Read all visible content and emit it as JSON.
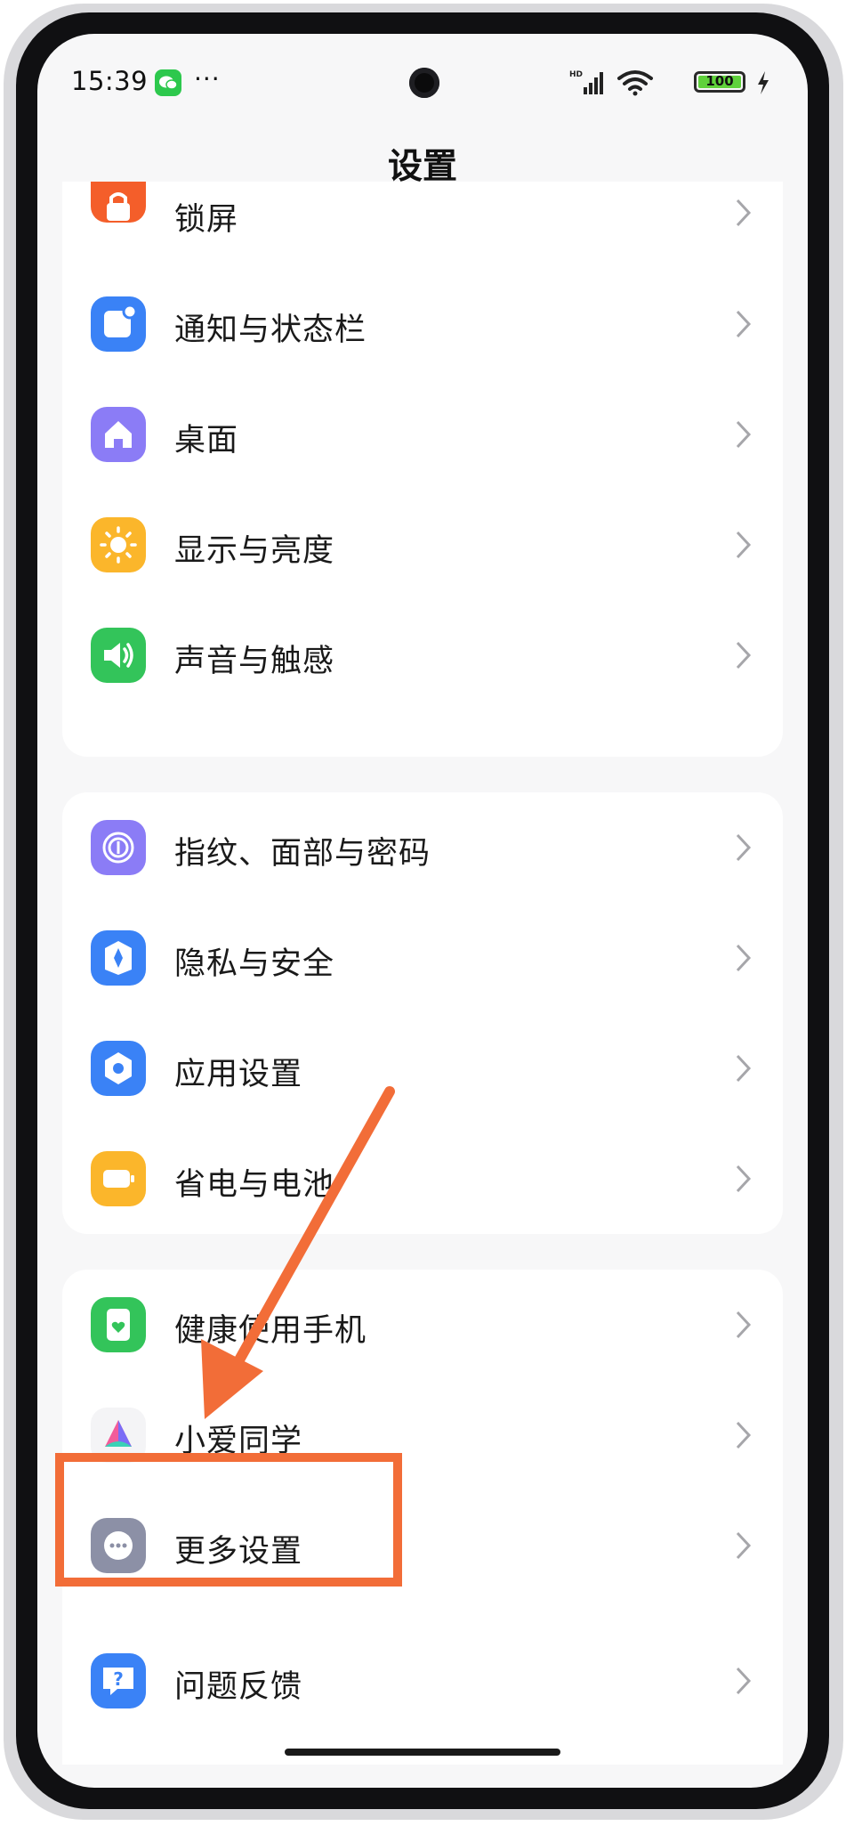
{
  "status_bar": {
    "time": "15:39",
    "more": "···",
    "battery": "100"
  },
  "header": {
    "title": "设置"
  },
  "colors": {
    "orange": "#f45e2a",
    "blue": "#3a82f6",
    "purple": "#8b7cf6",
    "yellow": "#fbb62b",
    "green": "#33c45a",
    "gray": "#8c90a6",
    "annotation": "#f26d38"
  },
  "groups": [
    {
      "items": [
        {
          "label": "锁屏",
          "icon": "lock-icon"
        },
        {
          "label": "通知与状态栏",
          "icon": "notification-icon"
        },
        {
          "label": "桌面",
          "icon": "home-icon"
        },
        {
          "label": "显示与亮度",
          "icon": "sun-icon"
        },
        {
          "label": "声音与触感",
          "icon": "speaker-icon"
        }
      ]
    },
    {
      "items": [
        {
          "label": "指纹、面部与密码",
          "icon": "fingerprint-icon"
        },
        {
          "label": "隐私与安全",
          "icon": "privacy-icon"
        },
        {
          "label": "应用设置",
          "icon": "app-settings-icon"
        },
        {
          "label": "省电与电池",
          "icon": "battery-saver-icon"
        }
      ]
    },
    {
      "items": [
        {
          "label": "健康使用手机",
          "icon": "healthy-phone-icon"
        },
        {
          "label": "小爱同学",
          "icon": "xiaoai-icon"
        },
        {
          "label": "更多设置",
          "icon": "more-settings-icon"
        },
        {
          "label": "问题反馈",
          "icon": "feedback-icon"
        }
      ]
    }
  ]
}
